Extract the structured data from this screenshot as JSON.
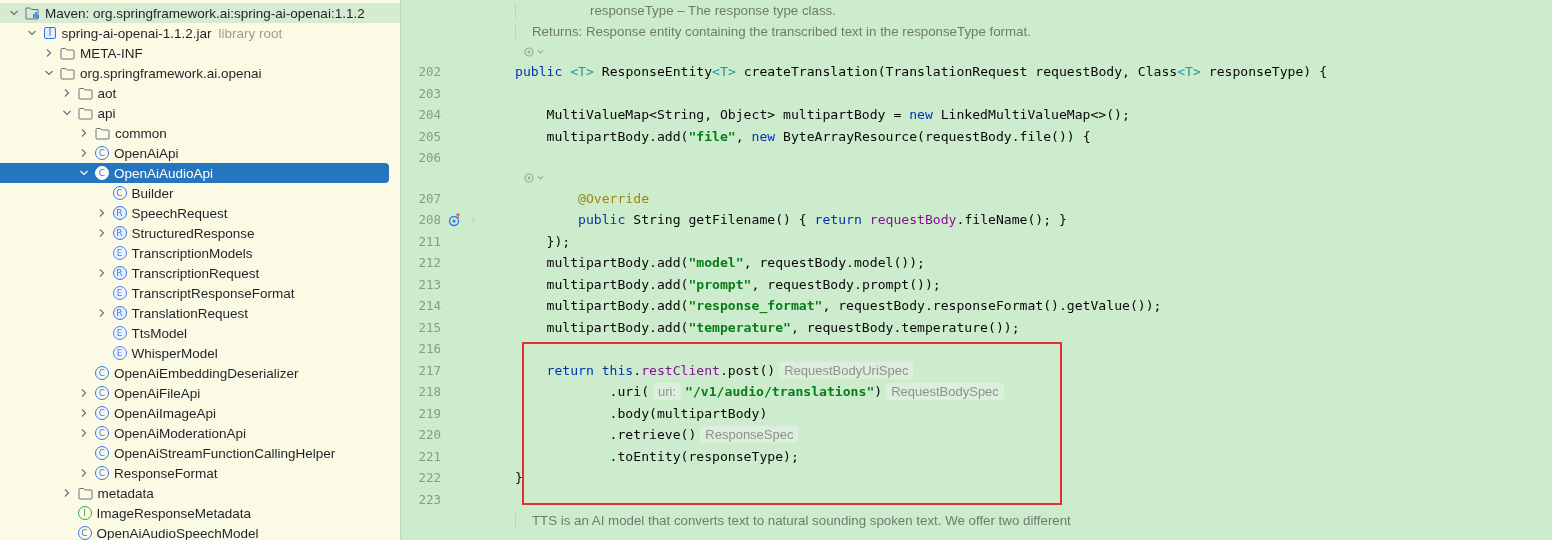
{
  "project_tree": {
    "items": [
      {
        "kind": "module",
        "label": "Maven: org.springframework.ai:spring-ai-openai:1.1.2",
        "pinned": true,
        "selected": false,
        "expandable": true,
        "expanded": true,
        "children": [
          {
            "kind": "jar",
            "label": "spring-ai-openai-1.1.2.jar",
            "suffix": "library root",
            "pinned": false,
            "selected": false,
            "expandable": true,
            "expanded": true,
            "children": [
              {
                "kind": "folder",
                "label": "META-INF",
                "pinned": false,
                "selected": false,
                "expandable": true,
                "expanded": false
              },
              {
                "kind": "folder",
                "label": "org.springframework.ai.openai",
                "pinned": false,
                "selected": false,
                "expandable": true,
                "expanded": true,
                "children": [
                  {
                    "kind": "folder",
                    "label": "aot",
                    "pinned": false,
                    "selected": false,
                    "expandable": true,
                    "expanded": false
                  },
                  {
                    "kind": "folder",
                    "label": "api",
                    "pinned": false,
                    "selected": false,
                    "expandable": true,
                    "expanded": true,
                    "children": [
                      {
                        "kind": "folder",
                        "label": "common",
                        "pinned": false,
                        "selected": false,
                        "expandable": true,
                        "expanded": false
                      },
                      {
                        "kind": "class",
                        "icon_letter": "C",
                        "label": "OpenAiApi",
                        "pinned": false,
                        "selected": false,
                        "expandable": true,
                        "expanded": false
                      },
                      {
                        "kind": "class",
                        "icon_letter": "C",
                        "label": "OpenAiAudioApi",
                        "pinned": false,
                        "selected": true,
                        "expandable": true,
                        "expanded": true,
                        "children": [
                          {
                            "kind": "class",
                            "icon_letter": "C",
                            "label": "Builder",
                            "pinned": false,
                            "selected": false,
                            "expandable": false,
                            "expanded": false
                          },
                          {
                            "kind": "record",
                            "icon_letter": "R",
                            "label": "SpeechRequest",
                            "pinned": false,
                            "selected": false,
                            "expandable": true,
                            "expanded": false
                          },
                          {
                            "kind": "record",
                            "icon_letter": "R",
                            "label": "StructuredResponse",
                            "pinned": false,
                            "selected": false,
                            "expandable": true,
                            "expanded": false
                          },
                          {
                            "kind": "enum",
                            "icon_letter": "E",
                            "label": "TranscriptionModels",
                            "pinned": false,
                            "selected": false,
                            "expandable": false,
                            "expanded": false
                          },
                          {
                            "kind": "record",
                            "icon_letter": "R",
                            "label": "TranscriptionRequest",
                            "pinned": false,
                            "selected": false,
                            "expandable": true,
                            "expanded": false
                          },
                          {
                            "kind": "enum",
                            "icon_letter": "E",
                            "label": "TranscriptResponseFormat",
                            "pinned": false,
                            "selected": false,
                            "expandable": false,
                            "expanded": false
                          },
                          {
                            "kind": "record",
                            "icon_letter": "R",
                            "label": "TranslationRequest",
                            "pinned": false,
                            "selected": false,
                            "expandable": true,
                            "expanded": false
                          },
                          {
                            "kind": "enum",
                            "icon_letter": "E",
                            "label": "TtsModel",
                            "pinned": false,
                            "selected": false,
                            "expandable": false,
                            "expanded": false
                          },
                          {
                            "kind": "enum",
                            "icon_letter": "E",
                            "label": "WhisperModel",
                            "pinned": false,
                            "selected": false,
                            "expandable": false,
                            "expanded": false
                          }
                        ]
                      },
                      {
                        "kind": "class",
                        "icon_letter": "C",
                        "label": "OpenAiEmbeddingDeserializer",
                        "pinned": false,
                        "selected": false,
                        "expandable": false,
                        "expanded": false
                      },
                      {
                        "kind": "class",
                        "icon_letter": "C",
                        "label": "OpenAiFileApi",
                        "pinned": false,
                        "selected": false,
                        "expandable": true,
                        "expanded": false
                      },
                      {
                        "kind": "class",
                        "icon_letter": "C",
                        "label": "OpenAiImageApi",
                        "pinned": false,
                        "selected": false,
                        "expandable": true,
                        "expanded": false
                      },
                      {
                        "kind": "class",
                        "icon_letter": "C",
                        "label": "OpenAiModerationApi",
                        "pinned": false,
                        "selected": false,
                        "expandable": true,
                        "expanded": false
                      },
                      {
                        "kind": "class",
                        "icon_letter": "C",
                        "label": "OpenAiStreamFunctionCallingHelper",
                        "pinned": false,
                        "selected": false,
                        "expandable": false,
                        "expanded": false
                      },
                      {
                        "kind": "class",
                        "icon_letter": "C",
                        "label": "ResponseFormat",
                        "pinned": false,
                        "selected": false,
                        "expandable": true,
                        "expanded": false
                      }
                    ]
                  },
                  {
                    "kind": "folder",
                    "label": "metadata",
                    "pinned": false,
                    "selected": false,
                    "expandable": true,
                    "expanded": false
                  },
                  {
                    "kind": "interface",
                    "icon_letter": "I",
                    "label": "ImageResponseMetadata",
                    "pinned": false,
                    "selected": false,
                    "expandable": false,
                    "expanded": false
                  },
                  {
                    "kind": "class",
                    "icon_letter": "C",
                    "label": "OpenAiAudioSpeechModel",
                    "pinned": false,
                    "selected": false,
                    "expandable": false,
                    "expanded": false
                  }
                ]
              }
            ]
          }
        ]
      }
    ]
  },
  "editor": {
    "rows": [
      {
        "kind": "doc-param",
        "text": "responseType – The response type class."
      },
      {
        "kind": "doc",
        "text": "Returns: Response entity containing the transcribed text in the responseType format."
      },
      {
        "kind": "lens"
      },
      {
        "kind": "code",
        "number": "202",
        "marker": false,
        "tokens": [
          {
            "kind": "keyword",
            "text": "public"
          },
          {
            "kind": "type",
            "text": " <T>"
          },
          {
            "kind": "plain",
            "text": " ResponseEntity"
          },
          {
            "kind": "type",
            "text": "<T>"
          },
          {
            "kind": "plain",
            "text": " createTranslation(TranslationRequest requestBody, Class"
          },
          {
            "kind": "type",
            "text": "<T>"
          },
          {
            "kind": "plain",
            "text": " responseType) {"
          }
        ]
      },
      {
        "kind": "code",
        "number": "203",
        "marker": false,
        "tokens": []
      },
      {
        "kind": "code",
        "number": "204",
        "marker": false,
        "tokens": [
          {
            "kind": "plain",
            "text": "    MultiValueMap<String, Object> multipartBody = "
          },
          {
            "kind": "keyword",
            "text": "new"
          },
          {
            "kind": "plain",
            "text": " LinkedMultiValueMap<>();"
          }
        ]
      },
      {
        "kind": "code",
        "number": "205",
        "marker": false,
        "tokens": [
          {
            "kind": "plain",
            "text": "    multipartBody.add("
          },
          {
            "kind": "string",
            "text": "\"file\""
          },
          {
            "kind": "plain",
            "text": ", "
          },
          {
            "kind": "keyword",
            "text": "new"
          },
          {
            "kind": "plain",
            "text": " ByteArrayResource(requestBody.file()) {"
          }
        ]
      },
      {
        "kind": "code",
        "number": "206",
        "marker": false,
        "tokens": []
      },
      {
        "kind": "lens"
      },
      {
        "kind": "code",
        "number": "207",
        "marker": false,
        "tokens": [
          {
            "kind": "annotation",
            "text": "        @Override"
          }
        ]
      },
      {
        "kind": "code",
        "number": "208",
        "marker": true,
        "tokens": [
          {
            "kind": "keyword",
            "text": "        public"
          },
          {
            "kind": "plain",
            "text": " String getFilename() { "
          },
          {
            "kind": "keyword",
            "text": "return"
          },
          {
            "kind": "field",
            "text": " requestBody"
          },
          {
            "kind": "plain",
            "text": ".fileName(); }"
          }
        ]
      },
      {
        "kind": "code",
        "number": "211",
        "marker": false,
        "tokens": [
          {
            "kind": "plain",
            "text": "    });"
          }
        ]
      },
      {
        "kind": "code",
        "number": "212",
        "marker": false,
        "tokens": [
          {
            "kind": "plain",
            "text": "    multipartBody.add("
          },
          {
            "kind": "string",
            "text": "\"model\""
          },
          {
            "kind": "plain",
            "text": ", requestBody.model());"
          }
        ]
      },
      {
        "kind": "code",
        "number": "213",
        "marker": false,
        "tokens": [
          {
            "kind": "plain",
            "text": "    multipartBody.add("
          },
          {
            "kind": "string",
            "text": "\"prompt\""
          },
          {
            "kind": "plain",
            "text": ", requestBody.prompt());"
          }
        ]
      },
      {
        "kind": "code",
        "number": "214",
        "marker": false,
        "tokens": [
          {
            "kind": "plain",
            "text": "    multipartBody.add("
          },
          {
            "kind": "string",
            "text": "\"response_format\""
          },
          {
            "kind": "plain",
            "text": ", requestBody.responseFormat().getValue());"
          }
        ]
      },
      {
        "kind": "code",
        "number": "215",
        "marker": false,
        "tokens": [
          {
            "kind": "plain",
            "text": "    multipartBody.add("
          },
          {
            "kind": "string",
            "text": "\"temperature\""
          },
          {
            "kind": "plain",
            "text": ", requestBody.temperature());"
          }
        ]
      },
      {
        "kind": "code",
        "number": "216",
        "marker": false,
        "tokens": []
      },
      {
        "kind": "framed",
        "rows": [
          {
            "kind": "code",
            "number": "217",
            "marker": false,
            "tokens": [
              {
                "kind": "keyword",
                "text": "    return this"
              },
              {
                "kind": "plain",
                "text": "."
              },
              {
                "kind": "field",
                "text": "restClient"
              },
              {
                "kind": "plain",
                "text": ".post()"
              },
              {
                "kind": "hint",
                "text": "RequestBodyUriSpec"
              }
            ]
          },
          {
            "kind": "code",
            "number": "218",
            "marker": false,
            "tokens": [
              {
                "kind": "plain",
                "text": "            .uri("
              },
              {
                "kind": "hint",
                "text": "uri:"
              },
              {
                "kind": "string",
                "text": "\"/v1/audio/translations\""
              },
              {
                "kind": "plain",
                "text": ")"
              },
              {
                "kind": "hint",
                "text": "RequestBodySpec"
              }
            ]
          },
          {
            "kind": "code",
            "number": "219",
            "marker": false,
            "tokens": [
              {
                "kind": "plain",
                "text": "            .body(multipartBody)"
              }
            ]
          },
          {
            "kind": "code",
            "number": "220",
            "marker": false,
            "tokens": [
              {
                "kind": "plain",
                "text": "            .retrieve()"
              },
              {
                "kind": "hint",
                "text": "ResponseSpec"
              }
            ]
          },
          {
            "kind": "code",
            "number": "221",
            "marker": false,
            "tokens": [
              {
                "kind": "plain",
                "text": "            .toEntity(responseType);"
              }
            ]
          },
          {
            "kind": "code",
            "number": "222",
            "marker": false,
            "tokens": [
              {
                "kind": "plain",
                "text": "}"
              }
            ]
          }
        ]
      },
      {
        "kind": "code",
        "number": "223",
        "marker": false,
        "tokens": []
      },
      {
        "kind": "doc",
        "text": "TTS is an AI model that converts text to natural sounding spoken text. We offer two different"
      }
    ]
  }
}
